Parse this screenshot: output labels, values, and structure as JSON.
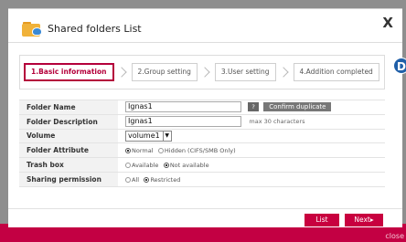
{
  "dialog": {
    "title": "Shared folders List",
    "close_label": "X"
  },
  "steps": [
    {
      "label": "1.Basic information",
      "active": true
    },
    {
      "label": "2.Group setting",
      "active": false
    },
    {
      "label": "3.User setting",
      "active": false
    },
    {
      "label": "4.Addition completed",
      "active": false
    }
  ],
  "badge": "D",
  "form": {
    "folder_name": {
      "label": "Folder Name",
      "value": "Ignas1",
      "help": "?",
      "confirm": "Confirm duplicate"
    },
    "folder_description": {
      "label": "Folder Description",
      "value": "Ignas1",
      "hint": "max 30 characters"
    },
    "volume": {
      "label": "Volume",
      "selected": "volume1",
      "arrow": "▼"
    },
    "folder_attribute": {
      "label": "Folder Attribute",
      "options": [
        "Normal",
        "Hidden (CIFS/SMB Only)"
      ],
      "selected_index": 0
    },
    "trash_box": {
      "label": "Trash box",
      "options": [
        "Available",
        "Not available"
      ],
      "selected_index": 1
    },
    "sharing_permission": {
      "label": "Sharing permission",
      "options": [
        "All",
        "Restricted"
      ],
      "selected_index": 1
    }
  },
  "buttons": {
    "list": "List",
    "next": "Next▸"
  },
  "backdrop": {
    "link_text": "close"
  },
  "colors": {
    "accent": "#c8003f",
    "badge": "#1f5fa8"
  }
}
